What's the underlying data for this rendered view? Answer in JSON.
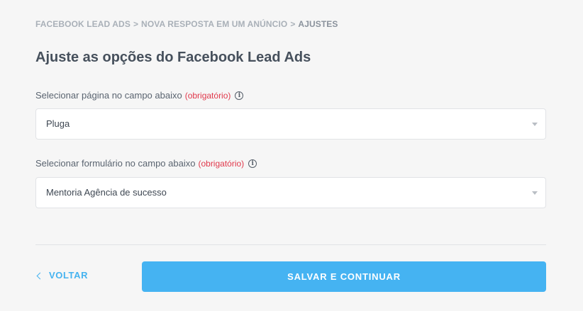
{
  "breadcrumb": {
    "items": [
      "FACEBOOK LEAD ADS",
      "NOVA RESPOSTA EM UM ANÚNCIO",
      "AJUSTES"
    ],
    "separator": ">"
  },
  "page": {
    "title": "Ajuste as opções do Facebook Lead Ads"
  },
  "fields": [
    {
      "label": "Selecionar página no campo abaixo",
      "required_text": "(obrigatório)",
      "info_icon": "info-icon",
      "value": "Pluga"
    },
    {
      "label": "Selecionar formulário no campo abaixo",
      "required_text": "(obrigatório)",
      "info_icon": "info-icon",
      "value": "Mentoria Agência de sucesso"
    }
  ],
  "footer": {
    "back_label": "VOLTAR",
    "submit_label": "SALVAR E CONTINUAR"
  },
  "colors": {
    "accent": "#45b3f2",
    "required": "#e0384b",
    "background": "#f6f6f6"
  }
}
